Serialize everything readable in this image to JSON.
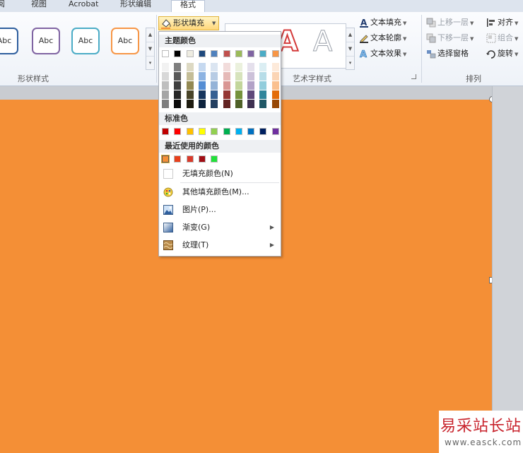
{
  "tabs": [
    {
      "label": "审阅",
      "shown": "阅"
    },
    {
      "label": "视图"
    },
    {
      "label": "Acrobat"
    },
    {
      "label": "形状编辑"
    },
    {
      "label": "格式"
    }
  ],
  "ribbon": {
    "shape_styles": {
      "label": "形状样式",
      "preset_text": "Abc",
      "preset_colors": [
        "#2f5f9e",
        "#8064a2",
        "#4bacc6",
        "#f79646"
      ]
    },
    "shape_fill_button": "形状填充",
    "wordart": {
      "label": "艺术字样式",
      "text_fill": "文本填充",
      "text_outline": "文本轮廓",
      "text_effects": "文本效果",
      "sample_letter": "A"
    },
    "arrange": {
      "label": "排列",
      "bring_forward": "上移一层",
      "send_backward": "下移一层",
      "selection_pane": "选择窗格",
      "align": "对齐",
      "group": "组合",
      "rotate": "旋转"
    }
  },
  "menu": {
    "theme_colors_header": "主题颜色",
    "theme_top": [
      "#ffffff",
      "#000000",
      "#eeece1",
      "#1f497d",
      "#4f81bd",
      "#c0504d",
      "#9bbb59",
      "#8064a2",
      "#4bacc6",
      "#f79646"
    ],
    "theme_shades": [
      [
        "#f2f2f2",
        "#7f7f7f",
        "#ddd9c3",
        "#c6d9f0",
        "#dbe5f1",
        "#f2dcdb",
        "#ebf1dd",
        "#e5e0ec",
        "#dbeef3",
        "#fdeada"
      ],
      [
        "#d8d8d8",
        "#595959",
        "#c4bd97",
        "#8db3e2",
        "#b8cce4",
        "#e5b9b7",
        "#d7e3bc",
        "#ccc1d9",
        "#b7dde8",
        "#fbd5b5"
      ],
      [
        "#bfbfbf",
        "#3f3f3f",
        "#938953",
        "#548dd4",
        "#95b3d7",
        "#d99694",
        "#c3d69b",
        "#b2a2c7",
        "#92cddc",
        "#fac08f"
      ],
      [
        "#a5a5a5",
        "#262626",
        "#494429",
        "#17365d",
        "#366092",
        "#953734",
        "#76923c",
        "#5f497a",
        "#31859b",
        "#e36c09"
      ],
      [
        "#7f7f7f",
        "#0c0c0c",
        "#1d1b10",
        "#0f243e",
        "#244061",
        "#632423",
        "#4f6128",
        "#3f3151",
        "#205867",
        "#974806"
      ]
    ],
    "standard_colors_header": "标准色",
    "standard": [
      "#c00000",
      "#ff0000",
      "#ffc000",
      "#ffff00",
      "#92d050",
      "#00b050",
      "#00b0f0",
      "#0070c0",
      "#002060",
      "#7030a0"
    ],
    "recent_colors_header": "最近使用的颜色",
    "recent": [
      "#f48f36",
      "#e8401c",
      "#d93a2b",
      "#a00d14",
      "#22e03a"
    ],
    "items": {
      "no_fill": "无填充颜色(N)",
      "more_colors": "其他填充颜色(M)...",
      "picture": "图片(P)...",
      "gradient": "渐变(G)",
      "texture": "纹理(T)"
    }
  },
  "colors": {
    "slide_fill": "#f48f36",
    "accent_highlight": "#ffd77a"
  },
  "watermark": {
    "title": "易采站长站",
    "url": "www.easck.com"
  }
}
